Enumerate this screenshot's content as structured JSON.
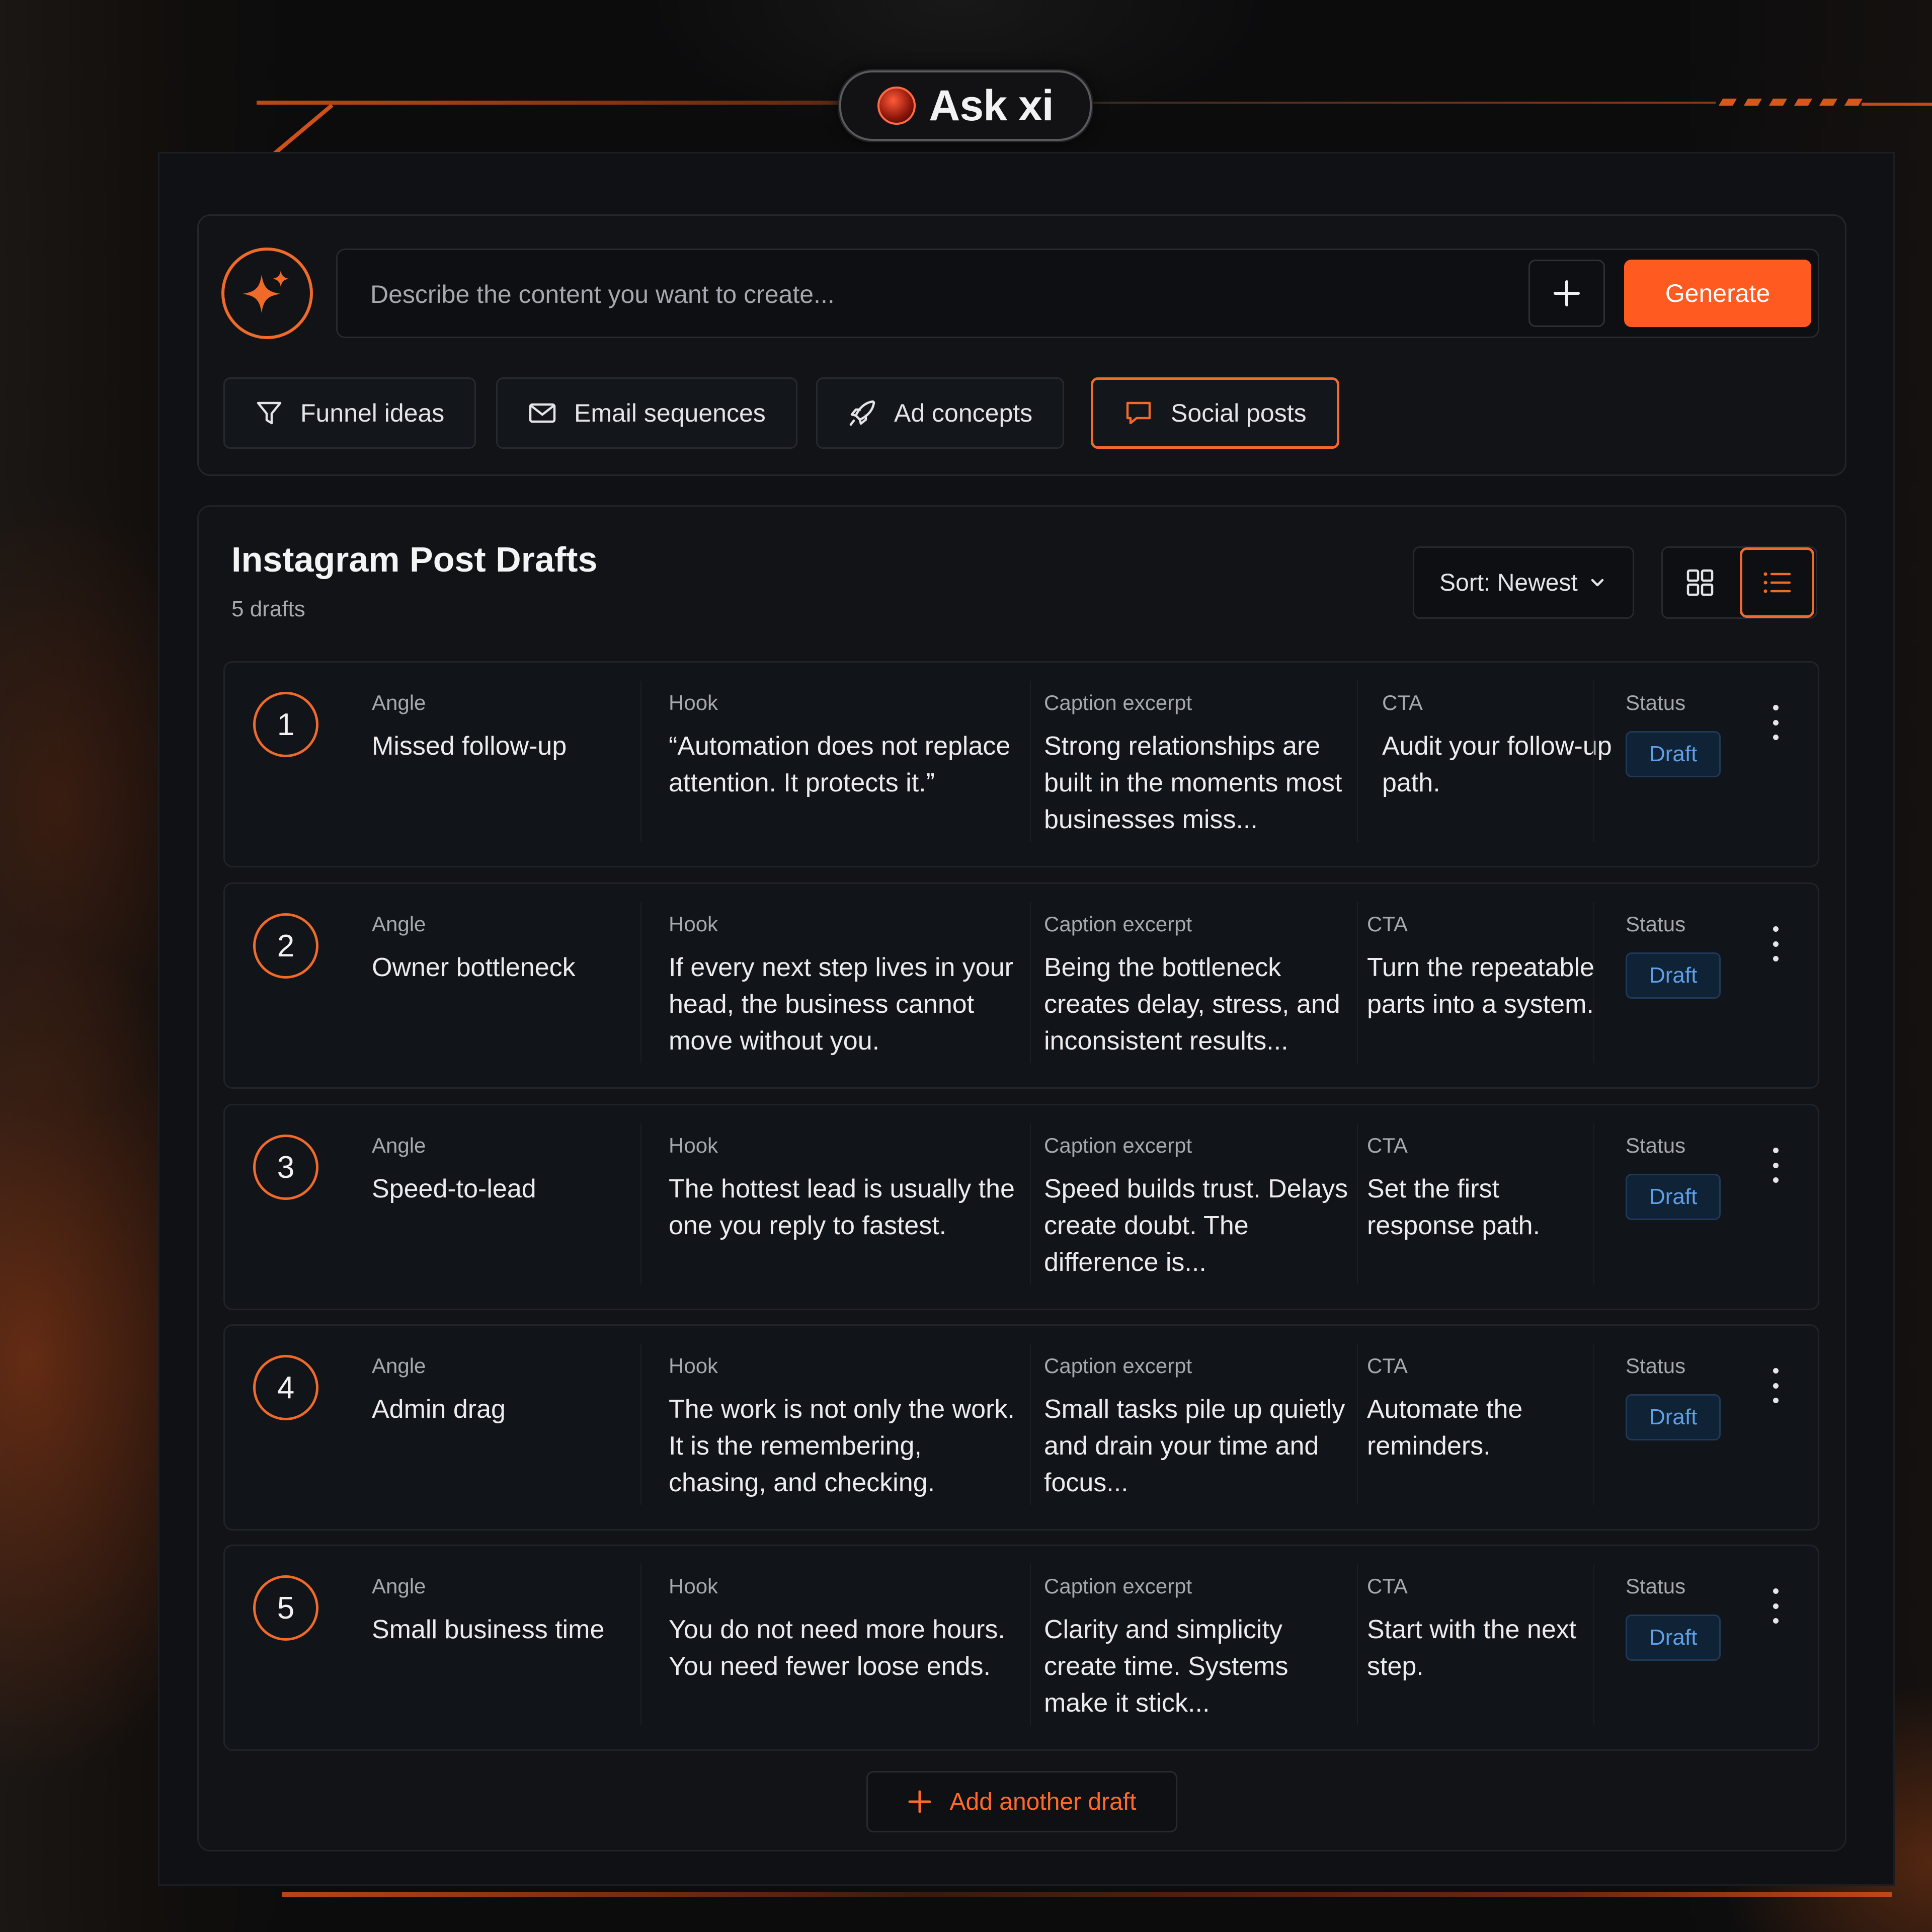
{
  "brand": {
    "name": "Ask xi",
    "logo_icon": "orb-logo-icon",
    "accent": "#ff5a1f"
  },
  "prompt": {
    "placeholder": "Describe the content you want to create...",
    "add_icon": "plus-icon",
    "generate_label": "Generate"
  },
  "chips": [
    {
      "label": "Funnel ideas",
      "icon": "funnel-icon",
      "active": false
    },
    {
      "label": "Email sequences",
      "icon": "mail-icon",
      "active": false
    },
    {
      "label": "Ad concepts",
      "icon": "rocket-icon",
      "active": false
    },
    {
      "label": "Social posts",
      "icon": "chat-bubble-icon",
      "active": true
    }
  ],
  "drafts": {
    "title": "Instagram Post Drafts",
    "count_label": "5 drafts",
    "sort_label": "Sort: Newest",
    "view_mode": "list",
    "column_labels": {
      "angle": "Angle",
      "hook": "Hook",
      "caption": "Caption excerpt",
      "cta": "CTA",
      "status": "Status"
    },
    "rows": [
      {
        "num": "1",
        "angle": "Missed follow-up",
        "hook": "“Automation does not replace attention. It protects it.”",
        "caption": "Strong relationships are built in the moments most businesses miss...",
        "cta": "Audit your follow-up path.",
        "status": "Draft"
      },
      {
        "num": "2",
        "angle": "Owner bottleneck",
        "hook": "If every next step lives in your head, the business cannot move without you.",
        "caption": "Being the bottleneck creates delay, stress, and inconsistent results...",
        "cta": "Turn the repeatable parts into a system.",
        "status": "Draft"
      },
      {
        "num": "3",
        "angle": "Speed-to-lead",
        "hook": "The hottest lead is usually the one you reply to fastest.",
        "caption": "Speed builds trust. Delays create doubt. The difference is...",
        "cta": "Set the first response path.",
        "status": "Draft"
      },
      {
        "num": "4",
        "angle": "Admin drag",
        "hook": "The work is not only the work. It is the remembering, chasing, and checking.",
        "caption": "Small tasks pile up quietly and drain your time and focus...",
        "cta": "Automate the reminders.",
        "status": "Draft"
      },
      {
        "num": "5",
        "angle": "Small business time",
        "hook": "You do not need more hours. You need fewer loose ends.",
        "caption": "Clarity and simplicity create time. Systems make it stick...",
        "cta": "Start with the next step.",
        "status": "Draft"
      }
    ],
    "add_label": "Add another draft"
  }
}
